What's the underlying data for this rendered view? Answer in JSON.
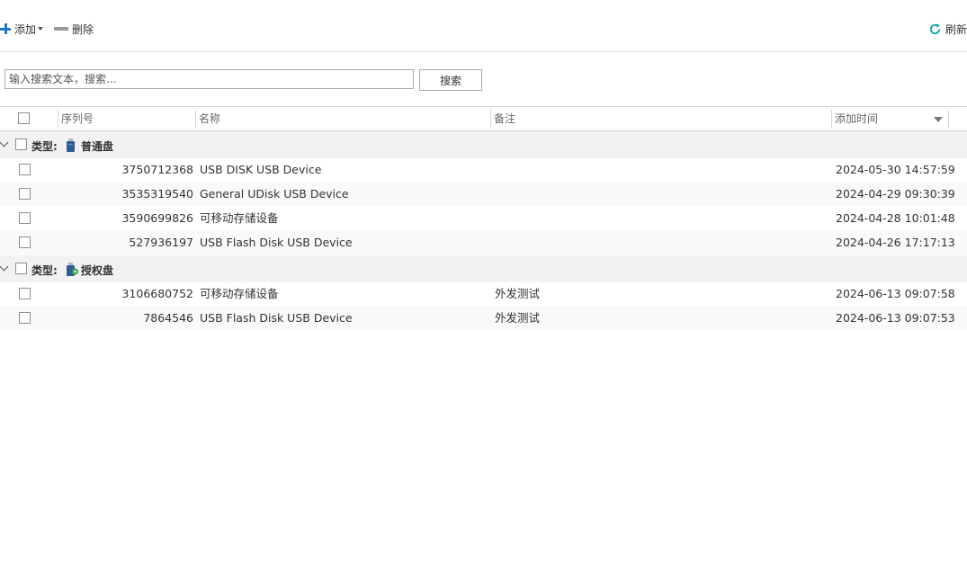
{
  "toolbar": {
    "add_label": "添加",
    "delete_label": "删除",
    "refresh_label": "刷新"
  },
  "search": {
    "placeholder": "输入搜索文本，搜索...",
    "value": "",
    "button_label": "搜索"
  },
  "columns": {
    "serial": "序列号",
    "name": "名称",
    "note": "备注",
    "added_time": "添加时间"
  },
  "groups": [
    {
      "type_label": "类型:",
      "name": "普通盘",
      "icon": "usb-drive-icon",
      "rows": [
        {
          "serial": "3750712368",
          "name": "USB DISK USB Device",
          "note": "",
          "time": "2024-05-30 14:57:59"
        },
        {
          "serial": "3535319540",
          "name": "General UDisk USB Device",
          "note": "",
          "time": "2024-04-29 09:30:39"
        },
        {
          "serial": "3590699826",
          "name": "可移动存储设备",
          "note": "",
          "time": "2024-04-28 10:01:48"
        },
        {
          "serial": "527936197",
          "name": "USB Flash Disk USB Device",
          "note": "",
          "time": "2024-04-26 17:17:13"
        }
      ]
    },
    {
      "type_label": "类型:",
      "name": "授权盘",
      "icon": "authorized-usb-drive-icon",
      "rows": [
        {
          "serial": "3106680752",
          "name": "可移动存储设备",
          "note": "外发测试",
          "time": "2024-06-13 09:07:58"
        },
        {
          "serial": "7864546",
          "name": "USB Flash Disk USB Device",
          "note": "外发测试",
          "time": "2024-06-13 09:07:53"
        }
      ]
    }
  ],
  "colors": {
    "accent": "#1f7ac6",
    "refresh": "#17a7a0",
    "group_bg": "#f2f2f2",
    "alt_row_bg": "#f9f9f9"
  }
}
